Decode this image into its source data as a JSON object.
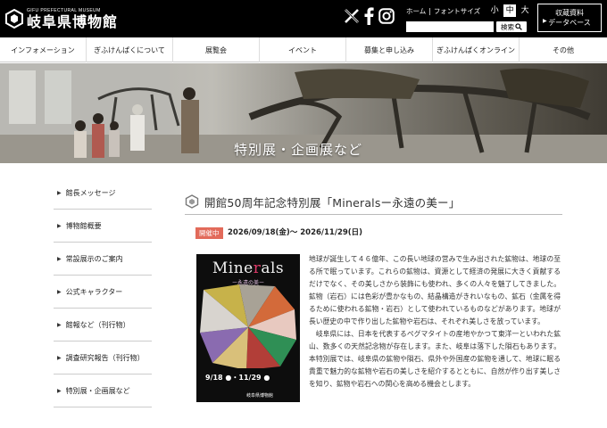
{
  "header": {
    "logo_sub": "GIFU PREFECTURAL MUSEUM",
    "logo_main": "岐阜県博物館",
    "home_label": "ホーム",
    "divider": "|",
    "font_size_label": "フォントサイズ",
    "font_sizes": [
      "小",
      "中",
      "大"
    ],
    "search_button": "検索",
    "db_button_line1": "収蔵資料",
    "db_button_line2": "データベース"
  },
  "nav": {
    "items": [
      "インフォメーション",
      "ぎふけんぱくについて",
      "展覧会",
      "イベント",
      "募集と申し込み",
      "ぎふけんぱくオンライン",
      "その他"
    ]
  },
  "hero": {
    "title": "特別展・企画展など"
  },
  "sidebar": {
    "items": [
      "館長メッセージ",
      "博物館概要",
      "常設展示のご案内",
      "公式キャラクター",
      "館報など（刊行物）",
      "調査研究報告（刊行物）",
      "特別展・企画展など"
    ]
  },
  "main": {
    "title": "開館50周年記念特別展「Mineralsー永遠の美ー」",
    "badge": "開催中",
    "dates": "2026/09/18(金)～ 2026/11/29(日)",
    "poster_title_a": "Mine",
    "poster_title_b": "r",
    "poster_title_c": "als",
    "poster_sub": "ー永遠の美ー",
    "poster_date": "9/18 ●・11/29 ●",
    "poster_museum": "岐阜県博物館",
    "paragraph1": "地球が誕生して４６億年、この長い地球の営みで生み出された鉱物は、地球の至る所で眠っています。これらの鉱物は、資源として経済の発展に大きく貢献するだけでなく、その美しさから装飾にも使われ、多くの人々を魅了してきました。鉱物（岩石）には色彩が豊かなもの、結晶構造がきれいなもの、鉱石（金属を得るために使われる鉱物・岩石）として使われているものなどがあります。地球が長い歴史の中で作り出した鉱物や岩石は、それぞれ美しさを放っています。",
    "paragraph2": "　岐阜県には、日本を代表するペグマタイトの産地やかつて東洋一といわれた鉱山、数多くの天然記念物が存在します。また、岐阜は落下した隕石もあります。本特別展では、岐阜県の鉱物や隕石、県外や外国産の鉱物を通して、地球に眠る貴重で魅力的な鉱物や岩石の美しさを紹介するとともに、自然が作り出す美しさを知り、鉱物や岩石への関心を高める機会とします。"
  },
  "colors": {
    "header_bg": "#000000",
    "badge_bg": "#e26a5a"
  }
}
